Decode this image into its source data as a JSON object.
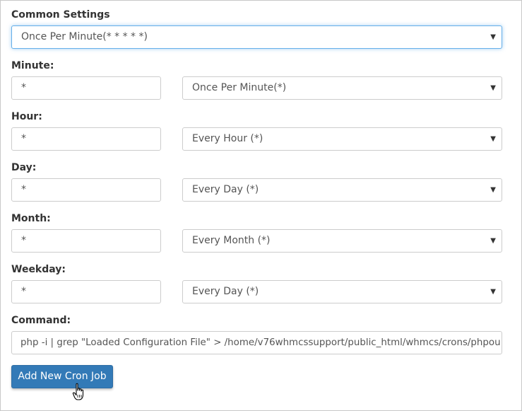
{
  "common_settings": {
    "label": "Common Settings",
    "selected": "Once Per Minute(* * * * *)"
  },
  "fields": [
    {
      "label": "Minute:",
      "value": "*",
      "selected": "Once Per Minute(*)"
    },
    {
      "label": "Hour:",
      "value": "*",
      "selected": "Every Hour (*)"
    },
    {
      "label": "Day:",
      "value": "*",
      "selected": "Every Day (*)"
    },
    {
      "label": "Month:",
      "value": "*",
      "selected": "Every Month (*)"
    },
    {
      "label": "Weekday:",
      "value": "*",
      "selected": "Every Day (*)"
    }
  ],
  "command": {
    "label": "Command:",
    "value": "php -i | grep \"Loaded Configuration File\" > /home/v76whmcssupport/public_html/whmcs/crons/phpou"
  },
  "submit_label": "Add New Cron Job",
  "icons": {
    "dropdown": "chevron-down-icon",
    "cursor": "hand-pointer-icon"
  }
}
